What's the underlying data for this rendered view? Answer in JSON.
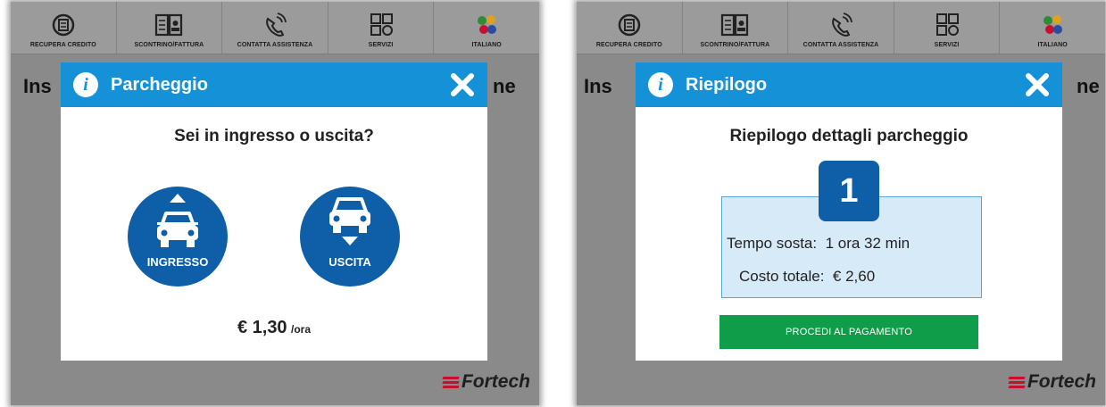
{
  "topbar": {
    "items": [
      {
        "label": "RECUPERA CREDITO",
        "icon": "recover-credit-icon"
      },
      {
        "label": "SCONTRINO/FATTURA",
        "icon": "receipt-invoice-icon"
      },
      {
        "label": "CONTATTA ASSISTENZA",
        "icon": "phone-assistance-icon"
      },
      {
        "label": "SERVIZI",
        "icon": "services-grid-icon"
      },
      {
        "label": "ITALIANO",
        "icon": "language-flags-icon"
      }
    ]
  },
  "background": {
    "title_left_fragment": "Ins",
    "title_right_fragment": "ne",
    "brand": "Fortech",
    "brand_color": "#c8102e"
  },
  "modal_parking": {
    "title": "Parcheggio",
    "question": "Sei in ingresso o uscita?",
    "entry_label": "INGRESSO",
    "exit_label": "USCITA",
    "price": "€ 1,30",
    "price_unit": "/ora"
  },
  "modal_summary": {
    "title": "Riepilogo",
    "subtitle": "Riepilogo dettagli parcheggio",
    "number": "1",
    "time_label": "Tempo sosta:",
    "time_value": "1 ora 32 min",
    "cost_label": "Costo totale:",
    "cost_value": "€ 2,60",
    "pay_button": "PROCEDI AL PAGAMENTO"
  },
  "colors": {
    "header_blue": "#1591d8",
    "button_blue": "#0e5fa8",
    "pay_green": "#0f9d4a",
    "summary_bg": "#d6eaf8"
  }
}
